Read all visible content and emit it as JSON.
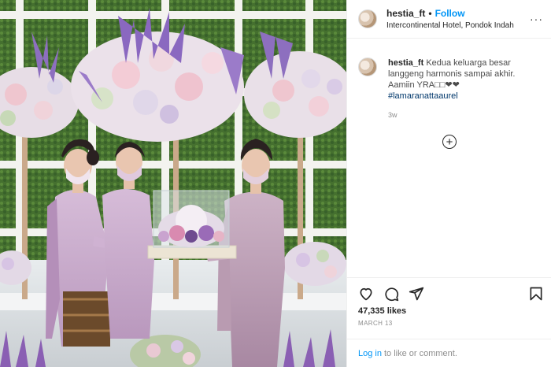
{
  "header": {
    "username": "hestia_ft",
    "separator": "•",
    "follow_label": "Follow",
    "location": "Intercontinental Hotel, Pondok Indah",
    "more_label": "···"
  },
  "caption": {
    "username": "hestia_ft",
    "text": "Kedua keluarga besar langgeng harmonis sampai akhir. Aamiin YRA□□❤❤",
    "hashtag": "#lamaranattaaurel",
    "time": "3w"
  },
  "more_comments_label": "+",
  "actions": {
    "likes": "47,335 likes",
    "date": "MARCH 13"
  },
  "login": {
    "link_label": "Log in",
    "rest_text": "to like or comment."
  },
  "colors": {
    "link_blue": "#0095f6",
    "hashtag_blue": "#00376b",
    "muted_gray": "#8e8e8e",
    "dress_lilac": "#c9a9cf",
    "backdrop_green": "#3f6b2f"
  }
}
